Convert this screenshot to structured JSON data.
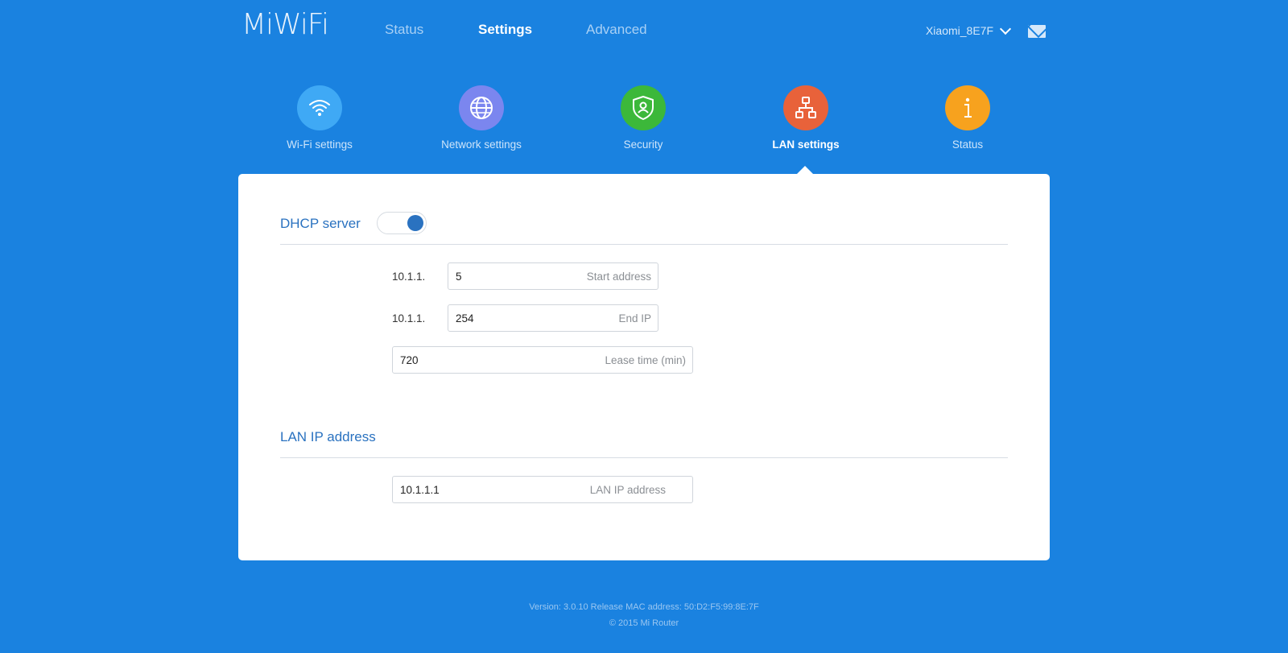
{
  "header": {
    "logo": "MiWiFi",
    "nav": [
      {
        "label": "Status"
      },
      {
        "label": "Settings"
      },
      {
        "label": "Advanced"
      }
    ],
    "device_name": "Xiaomi_8E7F"
  },
  "categories": [
    {
      "label": "Wi-Fi settings",
      "icon": "wifi-icon",
      "color": "#3fa9f5"
    },
    {
      "label": "Network settings",
      "icon": "globe-icon",
      "color": "#7b86ef"
    },
    {
      "label": "Security",
      "icon": "shield-icon",
      "color": "#3cb83a"
    },
    {
      "label": "LAN settings",
      "icon": "network-tree-icon",
      "color": "#e8623a"
    },
    {
      "label": "Status",
      "icon": "info-icon",
      "color": "#f7a21e"
    }
  ],
  "dhcp": {
    "title": "DHCP server",
    "enabled": true,
    "start_prefix": "10.1.1.",
    "start_value": "5",
    "start_placeholder": "Start address",
    "end_prefix": "10.1.1.",
    "end_value": "254",
    "end_placeholder": "End IP",
    "lease_value": "720",
    "lease_placeholder": "Lease time (min)"
  },
  "lan": {
    "title": "LAN IP address",
    "ip_value": "10.1.1.1",
    "ip_placeholder": "LAN IP address"
  },
  "footer": {
    "line1": "Version: 3.0.10 Release  MAC address: 50:D2:F5:99:8E:7F",
    "line2": "© 2015 Mi Router"
  }
}
